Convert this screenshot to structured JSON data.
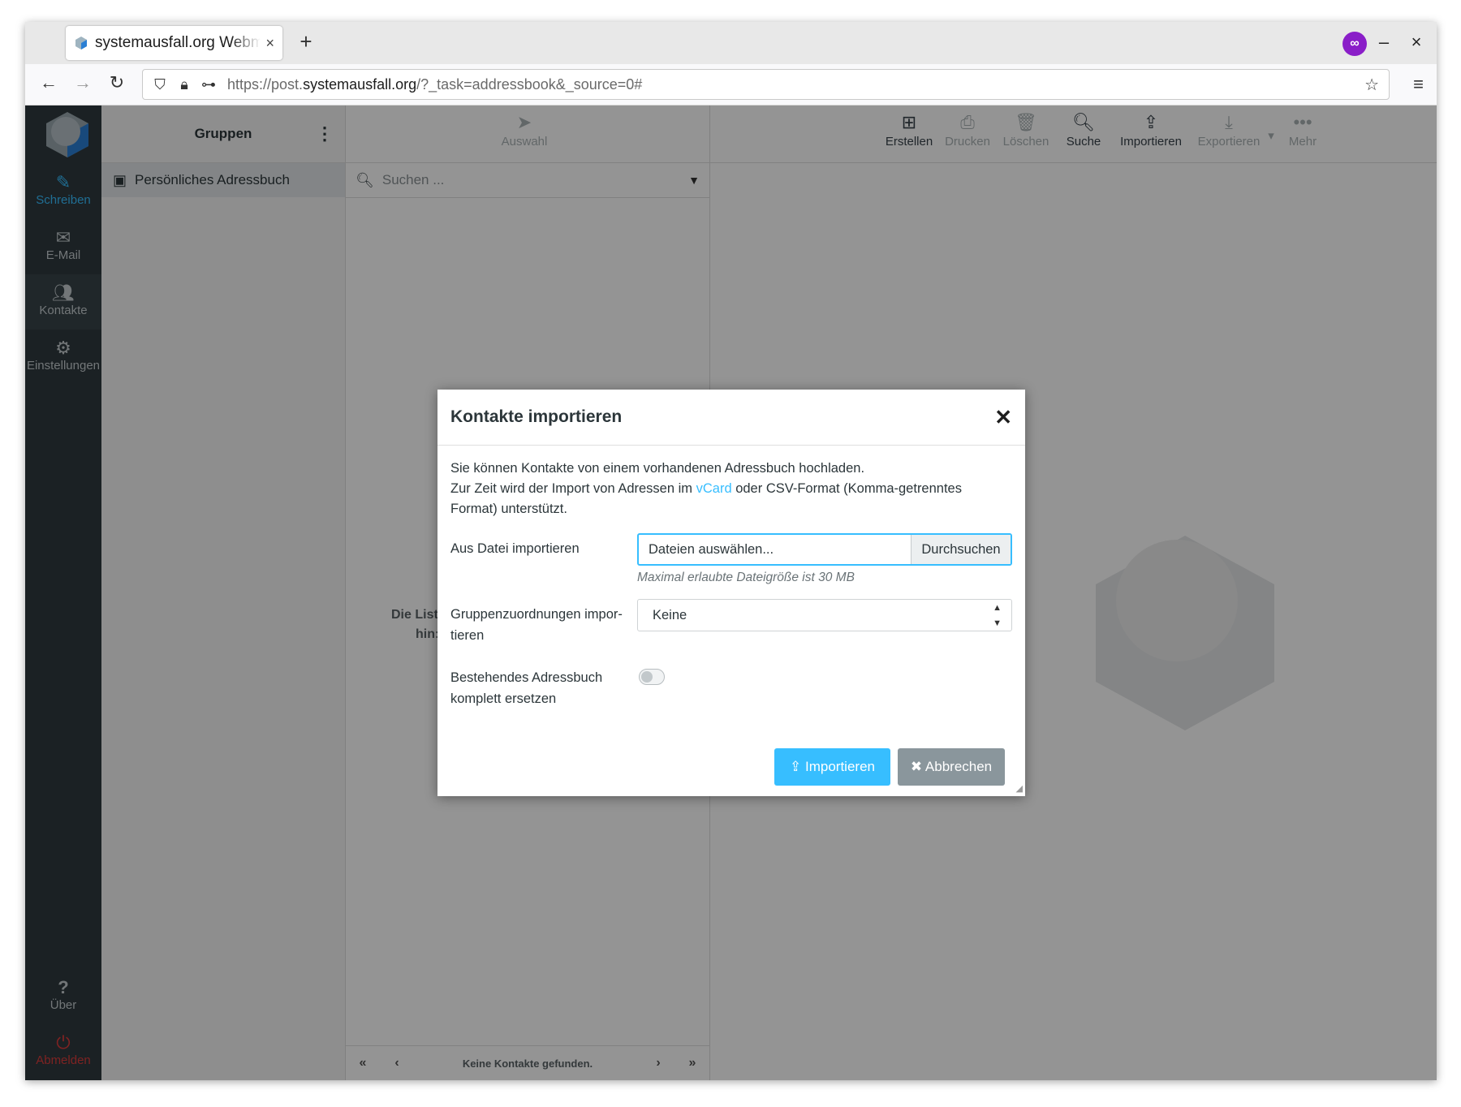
{
  "browser": {
    "tab_title": "systemausfall.org Webmail",
    "tab_close": "×",
    "new_tab": "+",
    "minimize": "–",
    "close": "×",
    "url_prefix": "https://post.",
    "url_domain": "systemausfall.org",
    "url_path": "/?_task=addressbook&_source=0#"
  },
  "sidebar": {
    "compose": "Schreiben",
    "mail": "E-Mail",
    "contacts": "Kontakte",
    "settings": "Einstellungen",
    "about": "Über",
    "logout": "Abmelden"
  },
  "groups": {
    "header": "Gruppen",
    "items": [
      {
        "label": "Persönliches Adressbuch"
      }
    ]
  },
  "list": {
    "toolbar_select": "Auswahl",
    "search_placeholder": "Suchen ...",
    "empty_message_line1": "Die List",
    "empty_message_line2": "hin:",
    "footer_text": "Keine Kontakte gefunden."
  },
  "toolbar": {
    "create": "Erstellen",
    "print": "Drucken",
    "delete": "Löschen",
    "search": "Suche",
    "import": "Importieren",
    "export": "Exportieren",
    "more": "Mehr"
  },
  "dialog": {
    "title": "Kontakte importieren",
    "intro_line1": "Sie können Kontakte von einem vorhandenen Adressbuch hochladen.",
    "intro_line2_a": "Zur Zeit wird der Import von Adressen im ",
    "intro_link": "vCard",
    "intro_line2_b": " oder CSV-Format (Komma-getrenntes",
    "intro_line3": "Format) unterstützt.",
    "file_label": "Aus Datei importieren",
    "file_value": "Dateien auswählen...",
    "browse_label": "Durchsuchen",
    "file_hint": "Maximal erlaubte Dateigröße ist 30 MB",
    "group_label_line1": "Gruppenzuordnungen impor-",
    "group_label_line2": "tieren",
    "group_select_value": "Keine",
    "replace_label_line1": "Bestehendes Adressbuch",
    "replace_label_line2": "komplett ersetzen",
    "replace_toggle": false,
    "import_button": "Importieren",
    "cancel_button": "Abbrechen"
  },
  "colors": {
    "accent": "#37beff",
    "sidebar_bg": "#2f3a3f",
    "danger": "#da3c3c",
    "cancel_button": "#8a969c"
  }
}
